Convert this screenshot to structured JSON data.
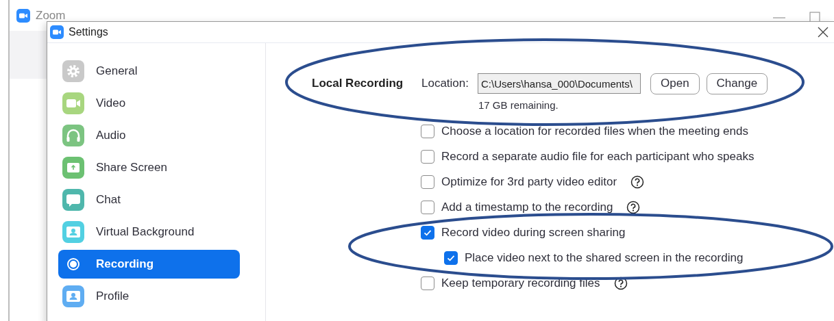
{
  "background_window": {
    "title": "Zoom"
  },
  "window": {
    "title": "Settings"
  },
  "sidebar": {
    "items": [
      {
        "label": "General",
        "kind": "gear",
        "color": "#c9c9c9",
        "selected": false
      },
      {
        "label": "Video",
        "kind": "video",
        "color": "#a8d67f",
        "selected": false
      },
      {
        "label": "Audio",
        "kind": "headphones",
        "color": "#7cc481",
        "selected": false
      },
      {
        "label": "Share Screen",
        "kind": "share",
        "color": "#6cc172",
        "selected": false
      },
      {
        "label": "Chat",
        "kind": "chat",
        "color": "#4fb7ac",
        "selected": false
      },
      {
        "label": "Virtual Background",
        "kind": "person",
        "color": "#52d0e2",
        "selected": false
      },
      {
        "label": "Recording",
        "kind": "record",
        "selected": true
      },
      {
        "label": "Profile",
        "kind": "person",
        "color": "#5fadf2",
        "selected": false
      }
    ]
  },
  "recording": {
    "heading": "Local Recording",
    "location_label": "Location:",
    "location_value": "C:\\Users\\hansa_000\\Documents\\",
    "buttons": [
      "Open",
      "Change"
    ],
    "remaining": "17 GB remaining.",
    "options": [
      {
        "label": "Choose a location for recorded files when the meeting ends",
        "checked": false,
        "help": false
      },
      {
        "label": "Record a separate audio file for each participant who speaks",
        "checked": false,
        "help": false
      },
      {
        "label": "Optimize for 3rd party video editor",
        "checked": false,
        "help": true
      },
      {
        "label": "Add a timestamp to the recording",
        "checked": false,
        "help": true
      },
      {
        "label": "Record video during screen sharing",
        "checked": true,
        "help": false,
        "children": [
          {
            "label": "Place video next to the shared screen in the recording",
            "checked": true,
            "help": false
          }
        ]
      },
      {
        "label": "Keep temporary recording files",
        "checked": false,
        "help": true
      }
    ]
  },
  "annotations": [
    {
      "kind": "ellipse"
    },
    {
      "kind": "ellipse"
    }
  ]
}
